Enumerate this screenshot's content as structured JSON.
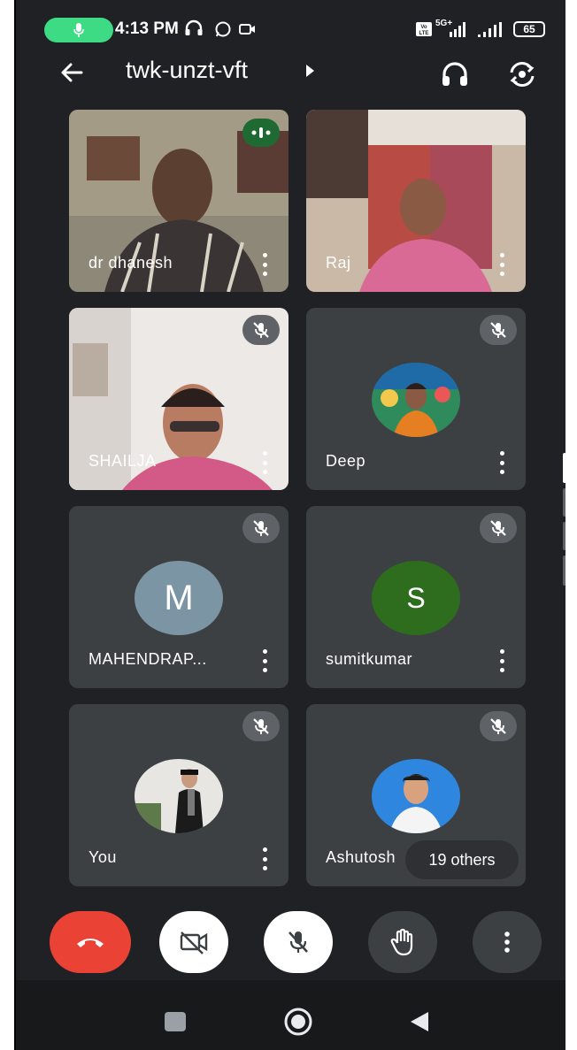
{
  "status_bar": {
    "time": "4:13 PM",
    "battery": "65",
    "network": "5G+",
    "volte": "Vo LTE"
  },
  "header": {
    "title": "twk-unzt-vft"
  },
  "participants": [
    {
      "name": "dr dhanesh",
      "state": "speaking",
      "avatar_type": "video"
    },
    {
      "name": "Raj",
      "state": "unmuted",
      "avatar_type": "video"
    },
    {
      "name": "SHAILJA",
      "state": "muted",
      "avatar_type": "video"
    },
    {
      "name": "Deep",
      "state": "muted",
      "avatar_type": "photo"
    },
    {
      "name": "MAHENDRAP...",
      "state": "muted",
      "avatar_type": "letter",
      "initial": "M",
      "avatar_color": "#7c95a4"
    },
    {
      "name": "sumitkumar",
      "state": "muted",
      "avatar_type": "letter",
      "initial": "S",
      "avatar_color": "#2e6c1e"
    },
    {
      "name": "You",
      "state": "muted",
      "avatar_type": "photo"
    },
    {
      "name": "Ashutosh",
      "state": "muted",
      "avatar_type": "photo"
    }
  ],
  "others_pill": "19 others",
  "controls": [
    {
      "name": "end-call",
      "icon": "phone-hangup-icon",
      "color": "#ea4335"
    },
    {
      "name": "camera-off",
      "icon": "video-off-icon",
      "color": "#ffffff"
    },
    {
      "name": "mic-off",
      "icon": "mic-off-icon",
      "color": "#ffffff"
    },
    {
      "name": "raise-hand",
      "icon": "hand-icon",
      "color": "#3c4043"
    },
    {
      "name": "more-options",
      "icon": "more-vert-icon",
      "color": "#3c4043"
    }
  ],
  "colors": {
    "background": "#202124",
    "tile": "#3c4043",
    "speaking_accent": "#1e6a32",
    "mic_pill": "#3ddc84"
  }
}
